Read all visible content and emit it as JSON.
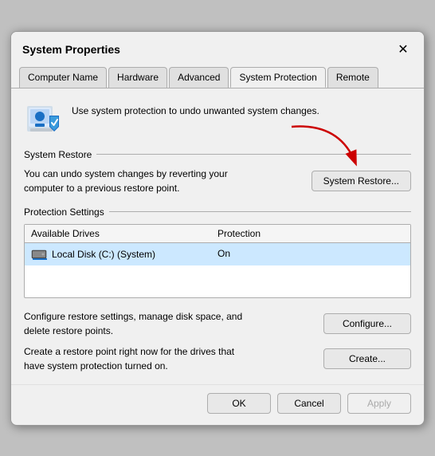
{
  "dialog": {
    "title": "System Properties",
    "close_label": "✕"
  },
  "tabs": [
    {
      "id": "computer-name",
      "label": "Computer Name",
      "active": false
    },
    {
      "id": "hardware",
      "label": "Hardware",
      "active": false
    },
    {
      "id": "advanced",
      "label": "Advanced",
      "active": false
    },
    {
      "id": "system-protection",
      "label": "System Protection",
      "active": true
    },
    {
      "id": "remote",
      "label": "Remote",
      "active": false
    }
  ],
  "header": {
    "description": "Use system protection to undo unwanted system changes."
  },
  "system_restore": {
    "section_label": "System Restore",
    "description": "You can undo system changes by reverting your computer to a previous restore point.",
    "button_label": "System Restore..."
  },
  "protection_settings": {
    "section_label": "Protection Settings",
    "col_drives": "Available Drives",
    "col_protection": "Protection",
    "drives": [
      {
        "name": "Local Disk (C:) (System)",
        "protection": "On"
      }
    ]
  },
  "configure": {
    "description": "Configure restore settings, manage disk space, and delete restore points.",
    "button_label": "Configure..."
  },
  "create": {
    "description": "Create a restore point right now for the drives that have system protection turned on.",
    "button_label": "Create..."
  },
  "footer": {
    "ok_label": "OK",
    "cancel_label": "Cancel",
    "apply_label": "Apply"
  }
}
